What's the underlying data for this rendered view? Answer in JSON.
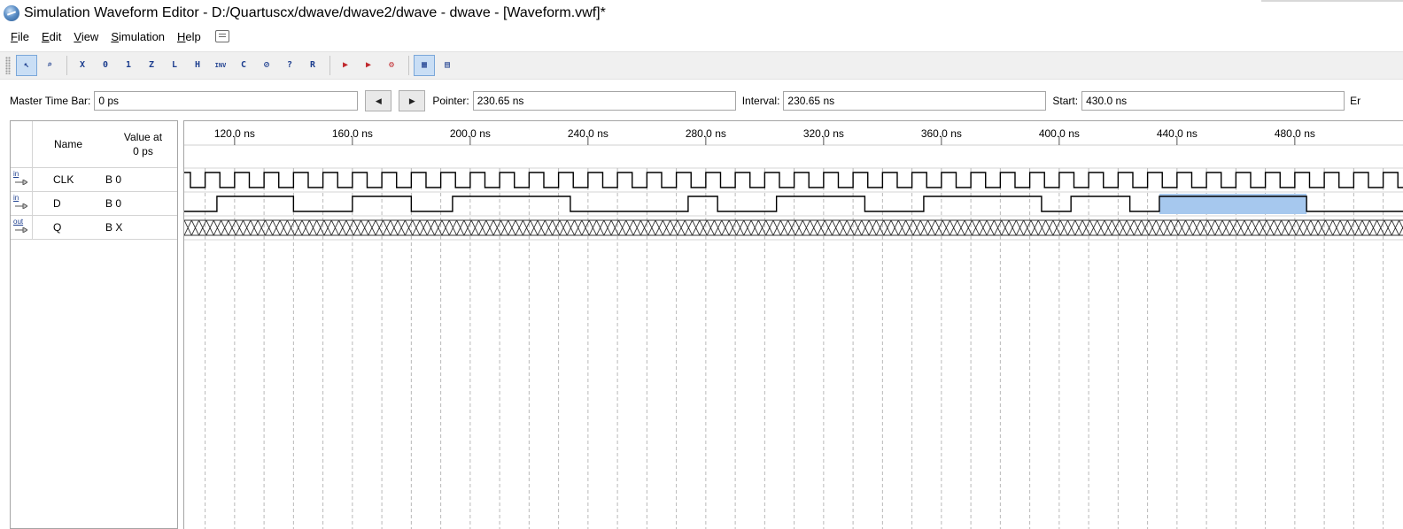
{
  "window": {
    "title": "Simulation Waveform Editor - D:/Quartuscx/dwave/dwave2/dwave - dwave - [Waveform.vwf]*"
  },
  "menu": [
    {
      "label": "File",
      "mnemonic": "F",
      "rest": "ile"
    },
    {
      "label": "Edit",
      "mnemonic": "E",
      "rest": "dit"
    },
    {
      "label": "View",
      "mnemonic": "V",
      "rest": "iew"
    },
    {
      "label": "Simulation",
      "mnemonic": "S",
      "rest": "imulation"
    },
    {
      "label": "Help",
      "mnemonic": "H",
      "rest": "elp"
    }
  ],
  "toolbar": {
    "buttons": [
      {
        "name": "selection-tool",
        "glyph": "↖",
        "active": true
      },
      {
        "name": "zoom-tool",
        "glyph": "⌕",
        "active": false
      },
      {
        "name": "force-unknown",
        "glyph": "X",
        "active": false
      },
      {
        "name": "force-low",
        "glyph": "0",
        "active": false
      },
      {
        "name": "force-high",
        "glyph": "1",
        "active": false
      },
      {
        "name": "force-high-impedance",
        "glyph": "Z",
        "active": false
      },
      {
        "name": "force-weak-low",
        "glyph": "L",
        "active": false
      },
      {
        "name": "force-weak-high",
        "glyph": "H",
        "active": false
      },
      {
        "name": "invert",
        "glyph": "INV",
        "active": false
      },
      {
        "name": "count-value",
        "glyph": "C",
        "active": false
      },
      {
        "name": "overwrite-clock",
        "glyph": "⊘",
        "active": false
      },
      {
        "name": "arbitrary-value",
        "glyph": "?",
        "active": false
      },
      {
        "name": "random-values",
        "glyph": "R",
        "active": false
      },
      {
        "name": "run-functional-simulation",
        "glyph": "▶",
        "active": false
      },
      {
        "name": "run-timing-simulation",
        "glyph": "▶",
        "active": false
      },
      {
        "name": "generate-netlist",
        "glyph": "⚙",
        "active": false
      },
      {
        "name": "snap-to-grid",
        "glyph": "▦",
        "active": true
      },
      {
        "name": "arrange-by-name",
        "glyph": "▤",
        "active": false
      }
    ]
  },
  "timebar": {
    "master_label": "Master Time Bar:",
    "master_value": "0 ps",
    "pointer_label": "Pointer:",
    "pointer_value": "230.65 ns",
    "interval_label": "Interval:",
    "interval_value": "230.65 ns",
    "start_label": "Start:",
    "start_value": "430.0 ns",
    "end_label_partial": "Er"
  },
  "names_panel": {
    "name_header": "Name",
    "value_header_line1": "Value at",
    "value_header_line2": "0 ps",
    "signals": [
      {
        "direction": "in",
        "name": "CLK",
        "value": "B 0"
      },
      {
        "direction": "in",
        "name": "D",
        "value": "B 0"
      },
      {
        "direction": "out",
        "name": "Q",
        "value": "B X"
      }
    ]
  },
  "colors": {
    "selection_fill": "#a6c8ee",
    "grid_line": "#b8b8b8",
    "wave_line": "#000000"
  },
  "waveform": {
    "ruler_ticks_ns": [
      120,
      160,
      200,
      240,
      280,
      320,
      360,
      400,
      440,
      480
    ],
    "ruler_labels": [
      "120.0 ns",
      "160.0 ns",
      "200.0 ns",
      "240.0 ns",
      "280.0 ns",
      "320.0 ns",
      "360.0 ns",
      "400.0 ns",
      "440.0 ns",
      "480.0 ns"
    ],
    "view_start_ns": 100,
    "view_end_ns": 510,
    "clk_period_ns": 10,
    "clk_high_ns": [
      [
        0,
        5
      ]
    ],
    "d_high_intervals_ns": [
      [
        114,
        140
      ],
      [
        160,
        180
      ],
      [
        194,
        234
      ],
      [
        274,
        284
      ],
      [
        304,
        334
      ],
      [
        354,
        394
      ],
      [
        404,
        424
      ],
      [
        434,
        484
      ]
    ],
    "d_selected_interval_ns": [
      434,
      484
    ],
    "q_value": "X"
  }
}
